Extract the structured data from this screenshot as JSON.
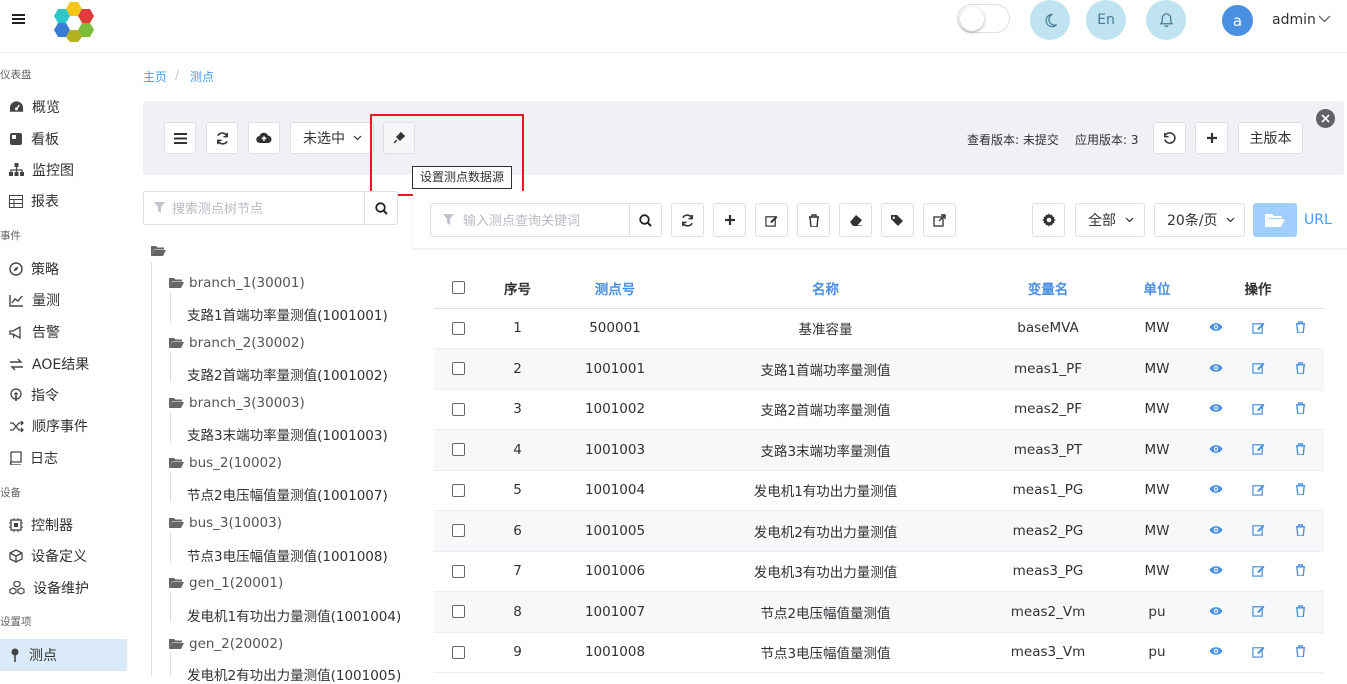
{
  "header": {
    "lang_label": "En",
    "avatar_letter": "a",
    "username": "admin"
  },
  "sidebar": {
    "sections": [
      {
        "title": "仪表盘",
        "items": [
          {
            "label": "概览",
            "icon": "dashboard-icon"
          },
          {
            "label": "看板",
            "icon": "board-icon"
          },
          {
            "label": "监控图",
            "icon": "sitemap-icon"
          },
          {
            "label": "报表",
            "icon": "table-icon"
          }
        ]
      },
      {
        "title": "事件",
        "items": [
          {
            "label": "策略",
            "icon": "compass-icon"
          },
          {
            "label": "量测",
            "icon": "line-chart-icon"
          },
          {
            "label": "告警",
            "icon": "bullhorn-icon"
          },
          {
            "label": "AOE结果",
            "icon": "exchange-icon"
          },
          {
            "label": "指令",
            "icon": "podcast-icon"
          },
          {
            "label": "顺序事件",
            "icon": "random-icon"
          },
          {
            "label": "日志",
            "icon": "book-icon"
          }
        ]
      },
      {
        "title": "设备",
        "items": [
          {
            "label": "控制器",
            "icon": "cpu-icon"
          },
          {
            "label": "设备定义",
            "icon": "cube-icon"
          },
          {
            "label": "设备维护",
            "icon": "cubes-icon"
          }
        ]
      },
      {
        "title": "设置项",
        "items": [
          {
            "label": "测点",
            "icon": "thumbtack-icon",
            "active": true
          }
        ]
      }
    ]
  },
  "breadcrumb": {
    "home": "主页",
    "current": "测点"
  },
  "toolbar": {
    "select_value": "未选中",
    "tooltip": "设置测点数据源",
    "view_version": "查看版本: 未提交",
    "apply_version": "应用版本: 3",
    "main_version_label": "主版本"
  },
  "tree": {
    "search_placeholder": "搜索测点树节点",
    "nodes": [
      {
        "label": "branch_1(30001)",
        "children": [
          "支路1首端功率量测值(1001001)"
        ]
      },
      {
        "label": "branch_2(30002)",
        "children": [
          "支路2首端功率量测值(1001002)"
        ]
      },
      {
        "label": "branch_3(30003)",
        "children": [
          "支路3末端功率量测值(1001003)"
        ]
      },
      {
        "label": "bus_2(10002)",
        "children": [
          "节点2电压幅值量测值(1001007)"
        ]
      },
      {
        "label": "bus_3(10003)",
        "children": [
          "节点3电压幅值量测值(1001008)"
        ]
      },
      {
        "label": "gen_1(20001)",
        "children": [
          "发电机1有功出力量测值(1001004)"
        ]
      },
      {
        "label": "gen_2(20002)",
        "children": [
          "发电机2有功出力量测值(1001005)"
        ]
      }
    ]
  },
  "query": {
    "placeholder": "输入测点查询关键词",
    "filter_value": "全部",
    "page_size": "20条/页",
    "url_label": "URL"
  },
  "table": {
    "headers": {
      "index": "序号",
      "id": "测点号",
      "name": "名称",
      "var": "变量名",
      "unit": "单位",
      "ops": "操作"
    },
    "rows": [
      {
        "index": "1",
        "id": "500001",
        "name": "基准容量",
        "var": "baseMVA",
        "unit": "MW"
      },
      {
        "index": "2",
        "id": "1001001",
        "name": "支路1首端功率量测值",
        "var": "meas1_PF",
        "unit": "MW"
      },
      {
        "index": "3",
        "id": "1001002",
        "name": "支路2首端功率量测值",
        "var": "meas2_PF",
        "unit": "MW"
      },
      {
        "index": "4",
        "id": "1001003",
        "name": "支路3末端功率量测值",
        "var": "meas3_PT",
        "unit": "MW"
      },
      {
        "index": "5",
        "id": "1001004",
        "name": "发电机1有功出力量测值",
        "var": "meas1_PG",
        "unit": "MW"
      },
      {
        "index": "6",
        "id": "1001005",
        "name": "发电机2有功出力量测值",
        "var": "meas2_PG",
        "unit": "MW"
      },
      {
        "index": "7",
        "id": "1001006",
        "name": "发电机3有功出力量测值",
        "var": "meas3_PG",
        "unit": "MW"
      },
      {
        "index": "8",
        "id": "1001007",
        "name": "节点2电压幅值量测值",
        "var": "meas2_Vm",
        "unit": "pu"
      },
      {
        "index": "9",
        "id": "1001008",
        "name": "节点3电压幅值量测值",
        "var": "meas3_Vm",
        "unit": "pu"
      }
    ]
  },
  "colors": {
    "accent": "#409eff",
    "highlight": "#e02020",
    "active_bg": "#dbeaf8"
  }
}
